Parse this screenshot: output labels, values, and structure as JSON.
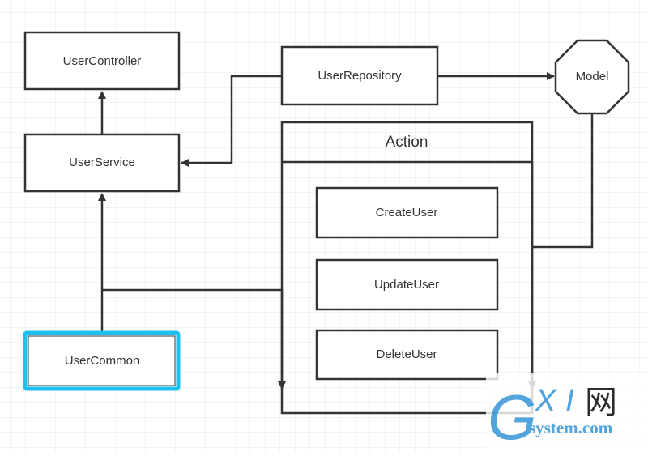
{
  "nodes": {
    "user_controller": "UserController",
    "user_service": "UserService",
    "user_repository": "UserRepository",
    "model": "Model",
    "action": "Action",
    "create_user": "CreateUser",
    "update_user": "UpdateUser",
    "delete_user": "DeleteUser",
    "user_common": "UserCommon"
  },
  "colors": {
    "stroke": "#333333",
    "grid": "#e8e8e8",
    "selected_border": "#1ec0f0",
    "watermark": "#4a9fdc"
  },
  "watermark": {
    "logo": "GXI网",
    "domain": "system.com"
  }
}
